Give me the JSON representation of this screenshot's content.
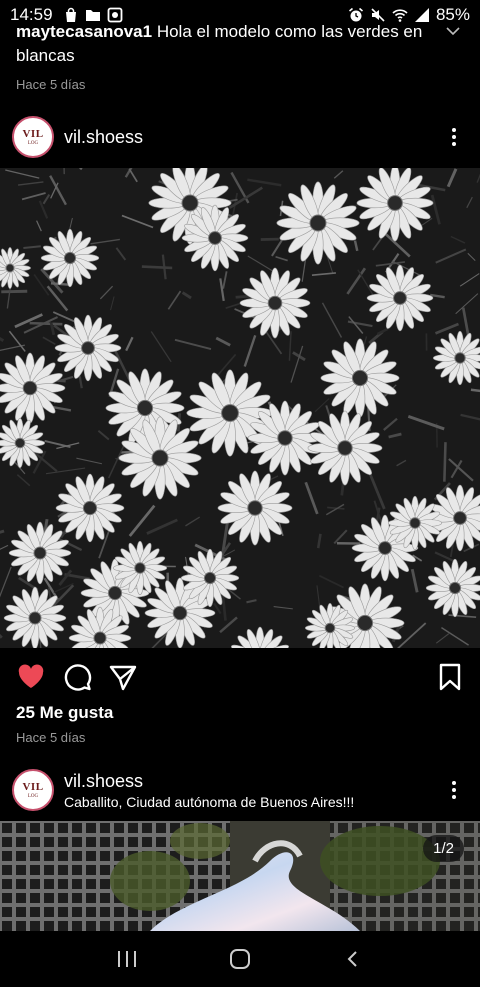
{
  "status_bar": {
    "time": "14:59",
    "battery": "85%",
    "left_icons": [
      "shopping-bag-icon",
      "folder-icon",
      "photo-icon"
    ],
    "right_icons": [
      "alarm-icon",
      "mute-icon",
      "wifi-icon",
      "signal-icon"
    ]
  },
  "comment": {
    "username": "maytecasanova1",
    "text": " Hola el modelo como las verdes en blancas",
    "time": "Hace 5 días"
  },
  "post1": {
    "username": "vil.shoess",
    "avatar_text": "VIL",
    "avatar_subtext": "LOG",
    "likes": "25 Me gusta",
    "time": "Hace 5 días",
    "liked": true,
    "like_color": "#ed4956"
  },
  "post2": {
    "username": "vil.shoess",
    "avatar_text": "VIL",
    "avatar_subtext": "LOG",
    "location": "Caballito, Ciudad autónoma de Buenos Aires!!!",
    "image_counter": "1/2"
  },
  "nav": {
    "icons": [
      "recent-apps-icon",
      "home-icon",
      "back-icon"
    ]
  }
}
